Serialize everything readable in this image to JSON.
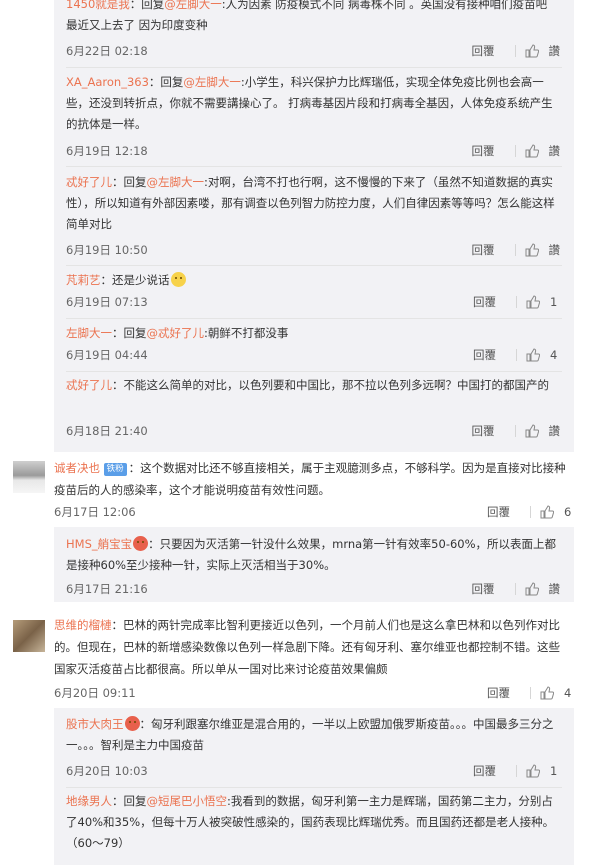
{
  "reply_label": "回覆",
  "thread1": {
    "replies": [
      {
        "user": "1450就是我",
        "prefix": "：回复",
        "at": "@左脚大一",
        "text": ":人为因素 防疫模式不同 病毒株不同 。英国没有接种咱们疫苗吧 最近又上去了 因为印度变种",
        "date": "6月22日 02:18",
        "likes": "讚"
      },
      {
        "user": "XA_Aaron_363",
        "prefix": "：回复",
        "at": "@左脚大一",
        "text": ":小学生，科兴保护力比辉瑞低，实现全体免疫比例也会高一些，还没到转折点，你就不需要講操心了。 打病毒基因片段和打病毒全基因，人体免疫系统产生的抗体是一样。",
        "date": "6月19日 12:18",
        "likes": "讚"
      },
      {
        "user": "忒好了儿",
        "prefix": "：回复",
        "at": "@左脚大一",
        "text": ":对啊，台湾不打也行啊，这不慢慢的下来了（虽然不知道数据的真实性），所以知道有外部因素喽，那有调查以色列智力防控力度，人们自律因素等等吗？怎么能这样简单对比",
        "date": "6月19日 10:50",
        "likes": "讚"
      },
      {
        "user": "芃莉艺",
        "prefix": "",
        "at": "",
        "text": "：还是少说话",
        "date": "6月19日 07:13",
        "likes": "1"
      },
      {
        "user": "左脚大一",
        "prefix": "：回复",
        "at": "@忒好了儿",
        "text": ":朝鲜不打都没事",
        "date": "6月19日 04:44",
        "likes": "4"
      },
      {
        "user": "忒好了儿",
        "prefix": "",
        "at": "",
        "text": "：不能这么简单的对比，以色列要和中国比，那不拉以色列多远啊？中国打的都国产的",
        "date": "6月18日 21:40",
        "likes": "讚"
      }
    ]
  },
  "comment1": {
    "user": "诚者决也",
    "badge": "铁粉",
    "text": "：这个数据对比还不够直接相关，属于主观臆测多点，不够科学。因为是直接对比接种疫苗后的人的感染率，这个才能说明疫苗有效性问题。",
    "date": "6月17日 12:06",
    "likes": "6",
    "replies": [
      {
        "user": "HMS_艄宝宝",
        "prefix": "",
        "at": "",
        "text": "：只要因为灭活第一针没什么效果，mrna第一针有效率50-60%，所以表面上都是接种60%至少接种一针，实际上灭活相当于30%。",
        "date": "6月17日 21:16",
        "likes": "讚"
      }
    ]
  },
  "comment2": {
    "user": "思维的榴槤",
    "text": "：巴林的两针完成率比智利更接近以色列，一个月前人们也是这么拿巴林和以色列作对比的。但现在，巴林的新增感染数像以色列一样急剧下降。还有匈牙利、塞尔维亚也都控制不错。这些国家灭活疫苗占比都很高。所以单从一国对比来讨论疫苗效果偏颇",
    "date": "6月20日 09:11",
    "likes": "4",
    "replies": [
      {
        "user": "股市大肉王",
        "prefix": "",
        "at": "",
        "text": "：匈牙利跟塞尔维亚是混合用的，一半以上欧盟加俄罗斯疫苗。。。中国最多三分之一。。。智利是主力中国疫苗",
        "date": "6月20日 10:03",
        "likes": "1"
      },
      {
        "user": "地缘男人",
        "prefix": "：回复",
        "at": "@短尾巴小悟空",
        "text": ":我看到的数据，匈牙利第一主力是辉瑞，国药第二主力，分别占了40%和35%，但每十万人被突破性感染的，国药表现比辉瑞优秀。而且国药还都是老人接种。（60～79）",
        "date": "",
        "likes": ""
      }
    ]
  }
}
